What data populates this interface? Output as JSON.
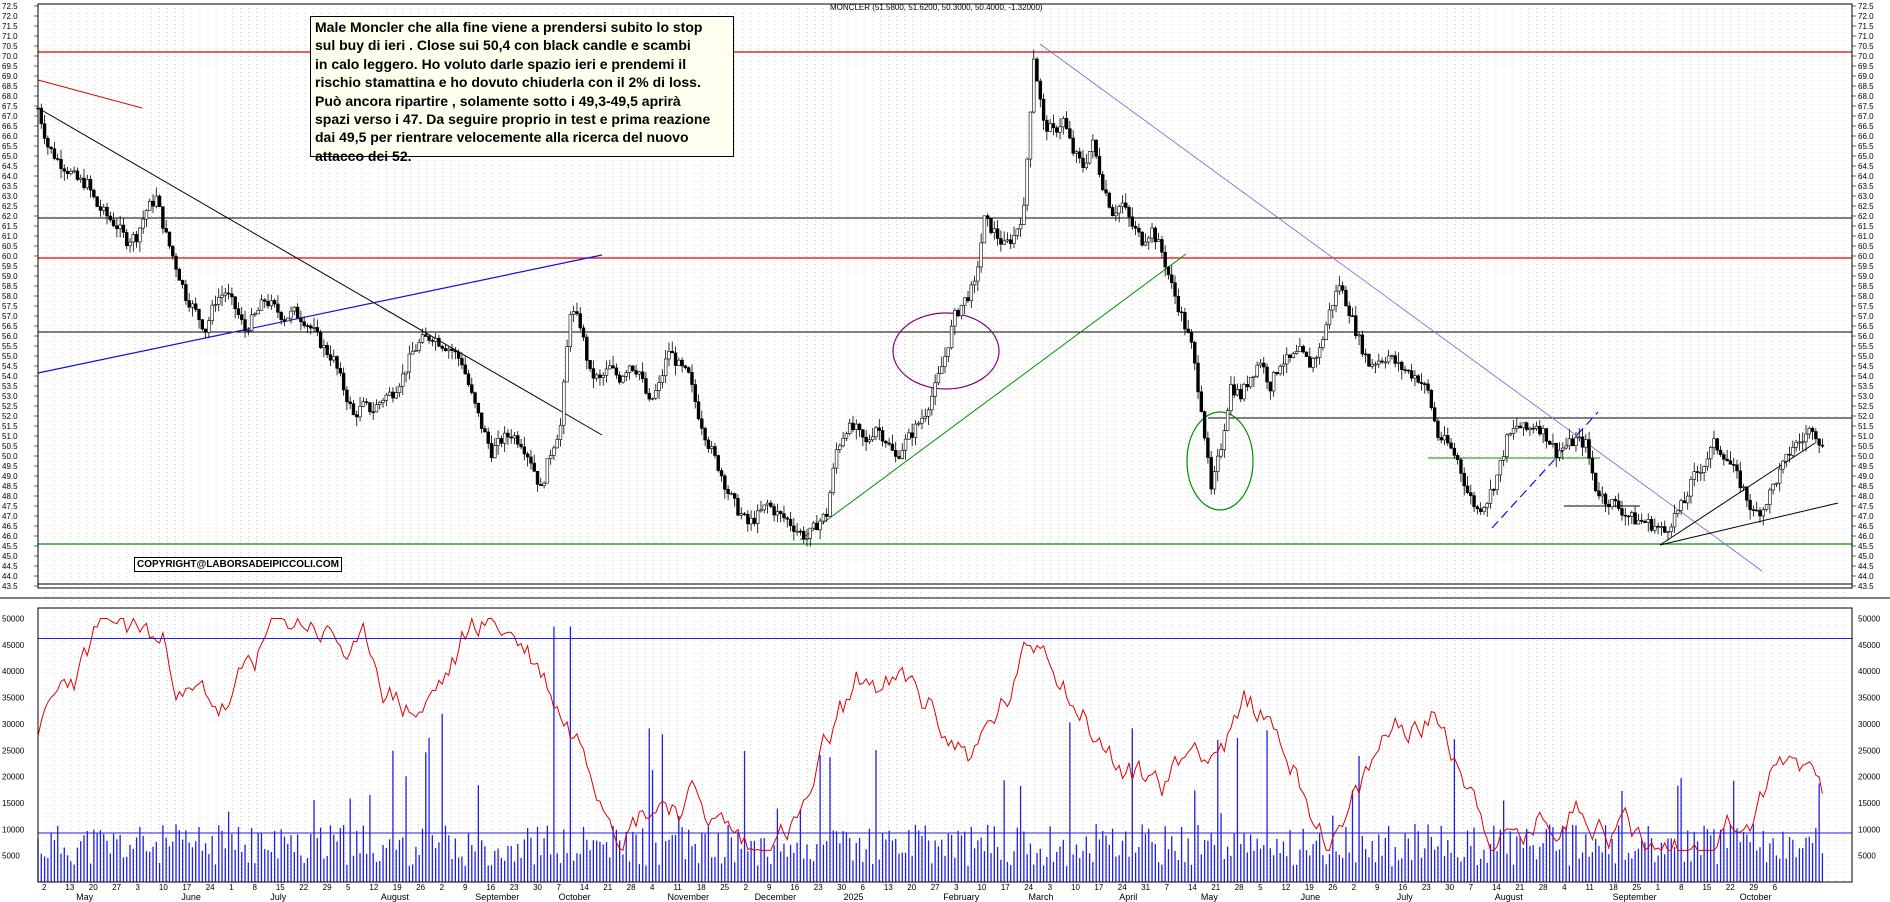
{
  "header": "MONCLER (51.5800, 51.6200, 50.3000, 50.4000, -1.32000)",
  "annotation": "Male Moncler che alla fine viene a prendersi subito lo stop\nsul buy di ieri . Close sui 50,4 con black candle e scambi\nin calo leggero. Ho voluto darle spazio ieri e prendemi il\nrischio stamattina e ho dovuto chiuderla con il 2% di loss.\nPuò ancora ripartire , solamente sotto i 49,3-49,5 aprirà\nspazi verso i 47.  Da seguire proprio in test e prima reazione\ndai 49,5 per rientrare velocemente alla ricerca del nuovo\nattacco dei 52.",
  "copyright": "COPYRIGHT@LABORSADEIPICCOLI.COM",
  "colors": {
    "price_line": "#000000",
    "red_levels": "#e00000",
    "support": "#009000",
    "trend_blue": "#1010e0",
    "trend_light": "#6a6ad0",
    "volume": "#2020e0",
    "volume_avg": "#e00000",
    "circle_purple": "#800080",
    "circle_green": "#009000"
  },
  "chart_data": [
    {
      "type": "candlestick",
      "title": "MONCLER (51.5800, 51.6200, 50.3000, 50.4000, -1.32000)",
      "ylim": [
        43.4,
        72.6
      ],
      "y_ticks": [
        43.5,
        44.0,
        44.5,
        45.0,
        45.5,
        46.0,
        46.5,
        47.0,
        47.5,
        48.0,
        48.5,
        49.0,
        49.5,
        50.0,
        50.5,
        51.0,
        51.5,
        52.0,
        52.5,
        53.0,
        53.5,
        54.0,
        54.5,
        55.0,
        55.5,
        56.0,
        56.5,
        57.0,
        57.5,
        58.0,
        58.5,
        59.0,
        59.5,
        60.0,
        60.5,
        61.0,
        61.5,
        62.0,
        62.5,
        63.0,
        63.5,
        64.0,
        64.5,
        65.0,
        65.5,
        66.0,
        66.5,
        67.0,
        67.5,
        68.0,
        68.5,
        69.0,
        69.5,
        70.0,
        70.5,
        71.0,
        71.5,
        72.0,
        72.5
      ],
      "y_tick_labels": [
        "43.5",
        "44.0",
        "44.5",
        "45.0",
        "45.5",
        "46.0",
        "46.5",
        "47.0",
        "47.5",
        "48.0",
        "48.5",
        "49.0",
        "49.5",
        "50.0",
        "50.5",
        "51.0",
        "51.5",
        "52.0",
        "52.5",
        "53.0",
        "53.5",
        "54.0",
        "54.5",
        "55.0",
        "55.5",
        "56.0",
        "56.5",
        "57.0",
        "57.5",
        "58.0",
        "58.5",
        "59.0",
        "59.5",
        "60.0",
        "60.5",
        "61.0",
        "61.5",
        "62.0",
        "62.5",
        "63.0",
        "63.5",
        "64.0",
        "64.5",
        "65.0",
        "65.5",
        "66.0",
        "66.5",
        "67.0",
        "67.5",
        "68.0",
        "68.5",
        "69.0",
        "69.5",
        "70.0",
        "70.5",
        "71.0",
        "71.5",
        "72.0",
        "72.5"
      ],
      "price_path": [
        [
          0,
          67.4
        ],
        [
          3,
          65.5
        ],
        [
          6,
          64.8
        ],
        [
          9,
          64.3
        ],
        [
          12,
          63.8
        ],
        [
          15,
          63.6
        ],
        [
          18,
          62.5
        ],
        [
          21,
          62.0
        ],
        [
          24,
          61.5
        ],
        [
          27,
          60.8
        ],
        [
          30,
          61.0
        ],
        [
          33,
          62.3
        ],
        [
          36,
          62.9
        ],
        [
          39,
          61.0
        ],
        [
          42,
          59.5
        ],
        [
          45,
          58.0
        ],
        [
          48,
          57.2
        ],
        [
          51,
          56.3
        ],
        [
          54,
          57.8
        ],
        [
          57,
          58.2
        ],
        [
          60,
          57.4
        ],
        [
          63,
          56.3
        ],
        [
          66,
          57.0
        ],
        [
          69,
          57.8
        ],
        [
          72,
          57.4
        ],
        [
          75,
          56.9
        ],
        [
          78,
          57.2
        ],
        [
          81,
          56.8
        ],
        [
          84,
          56.2
        ],
        [
          87,
          55.4
        ],
        [
          90,
          54.8
        ],
        [
          93,
          53.4
        ],
        [
          96,
          52.0
        ],
        [
          99,
          52.5
        ],
        [
          102,
          52.3
        ],
        [
          105,
          52.9
        ],
        [
          108,
          53.2
        ],
        [
          111,
          54.0
        ],
        [
          114,
          55.2
        ],
        [
          117,
          55.8
        ],
        [
          120,
          56.0
        ],
        [
          123,
          55.6
        ],
        [
          126,
          55.3
        ],
        [
          129,
          54.7
        ],
        [
          132,
          53.0
        ],
        [
          135,
          51.5
        ],
        [
          138,
          50.2
        ],
        [
          141,
          50.8
        ],
        [
          144,
          51.1
        ],
        [
          147,
          50.7
        ],
        [
          150,
          49.8
        ],
        [
          153,
          48.3
        ],
        [
          156,
          50.2
        ],
        [
          159,
          51.5
        ],
        [
          162,
          57.3
        ],
        [
          165,
          56.6
        ],
        [
          168,
          54.1
        ],
        [
          171,
          53.8
        ],
        [
          174,
          54.4
        ],
        [
          177,
          53.9
        ],
        [
          180,
          54.6
        ],
        [
          183,
          54.2
        ],
        [
          186,
          52.6
        ],
        [
          189,
          53.5
        ],
        [
          192,
          55.3
        ],
        [
          195,
          54.5
        ],
        [
          198,
          54.0
        ],
        [
          201,
          52.1
        ],
        [
          204,
          50.6
        ],
        [
          207,
          49.5
        ],
        [
          210,
          48.2
        ],
        [
          213,
          47.3
        ],
        [
          216,
          46.6
        ],
        [
          219,
          47.0
        ],
        [
          222,
          47.6
        ],
        [
          225,
          47.1
        ],
        [
          228,
          46.8
        ],
        [
          231,
          46.3
        ],
        [
          234,
          45.9
        ],
        [
          237,
          46.6
        ],
        [
          240,
          47.1
        ],
        [
          243,
          50.3
        ],
        [
          246,
          51.4
        ],
        [
          249,
          51.3
        ],
        [
          252,
          50.6
        ],
        [
          255,
          51.5
        ],
        [
          258,
          50.8
        ],
        [
          261,
          49.9
        ],
        [
          264,
          50.7
        ],
        [
          267,
          51.4
        ],
        [
          270,
          52.2
        ],
        [
          273,
          53.4
        ],
        [
          276,
          55.0
        ],
        [
          279,
          57.0
        ],
        [
          282,
          57.8
        ],
        [
          285,
          58.5
        ],
        [
          288,
          61.8
        ],
        [
          291,
          61.2
        ],
        [
          294,
          60.5
        ],
        [
          297,
          61.0
        ],
        [
          300,
          62.3
        ],
        [
          303,
          70.0
        ],
        [
          306,
          66.6
        ],
        [
          309,
          66.2
        ],
        [
          312,
          66.8
        ],
        [
          315,
          65.2
        ],
        [
          318,
          64.5
        ],
        [
          321,
          65.6
        ],
        [
          324,
          63.6
        ],
        [
          327,
          62.2
        ],
        [
          330,
          62.6
        ],
        [
          333,
          61.5
        ],
        [
          336,
          60.8
        ],
        [
          339,
          61.3
        ],
        [
          342,
          60.2
        ],
        [
          345,
          58.5
        ],
        [
          348,
          57.0
        ],
        [
          351,
          55.5
        ],
        [
          354,
          52.5
        ],
        [
          357,
          48.2
        ],
        [
          360,
          50.5
        ],
        [
          363,
          53.5
        ],
        [
          366,
          53.0
        ],
        [
          369,
          54.0
        ],
        [
          372,
          54.8
        ],
        [
          375,
          53.5
        ],
        [
          378,
          54.7
        ],
        [
          381,
          54.8
        ],
        [
          384,
          55.2
        ],
        [
          387,
          54.6
        ],
        [
          390,
          55.3
        ],
        [
          393,
          57.2
        ],
        [
          396,
          58.6
        ],
        [
          399,
          57.3
        ],
        [
          402,
          55.8
        ],
        [
          405,
          54.6
        ],
        [
          408,
          54.8
        ],
        [
          411,
          55.0
        ],
        [
          414,
          54.5
        ],
        [
          417,
          54.2
        ],
        [
          420,
          53.9
        ],
        [
          423,
          53.2
        ],
        [
          426,
          51.0
        ],
        [
          429,
          50.6
        ],
        [
          432,
          49.8
        ],
        [
          435,
          48.2
        ],
        [
          438,
          47.3
        ],
        [
          441,
          47.8
        ],
        [
          444,
          49.0
        ],
        [
          447,
          50.8
        ],
        [
          450,
          51.5
        ],
        [
          453,
          51.3
        ],
        [
          456,
          51.6
        ],
        [
          459,
          51.0
        ],
        [
          462,
          50.2
        ],
        [
          465,
          50.5
        ],
        [
          468,
          50.8
        ],
        [
          471,
          50.6
        ],
        [
          474,
          48.4
        ],
        [
          477,
          47.8
        ],
        [
          480,
          47.6
        ],
        [
          483,
          47.1
        ],
        [
          486,
          46.8
        ],
        [
          489,
          46.7
        ],
        [
          492,
          46.5
        ],
        [
          495,
          46.2
        ],
        [
          498,
          47.0
        ],
        [
          501,
          47.7
        ],
        [
          504,
          49.0
        ],
        [
          507,
          49.6
        ],
        [
          510,
          50.6
        ],
        [
          513,
          50.1
        ],
        [
          516,
          49.3
        ],
        [
          519,
          48.3
        ],
        [
          522,
          47.1
        ],
        [
          525,
          47.4
        ],
        [
          528,
          48.5
        ],
        [
          531,
          49.5
        ],
        [
          534,
          50.5
        ],
        [
          537,
          50.8
        ],
        [
          540,
          51.5
        ],
        [
          543,
          50.4
        ]
      ],
      "x_range_index": [
        0,
        552
      ],
      "month_labels": [
        "May",
        "June",
        "July",
        "August",
        "September",
        "October",
        "November",
        "December",
        "2025",
        "February",
        "March",
        "April",
        "May",
        "June",
        "July",
        "August",
        "September",
        "October"
      ],
      "day_labels": [
        "2",
        "13",
        "20",
        "27",
        "3",
        "10",
        "17",
        "24",
        "1",
        "8",
        "15",
        "22",
        "29",
        "5",
        "12",
        "19",
        "26",
        "2",
        "9",
        "16",
        "23",
        "30",
        "7",
        "14",
        "21",
        "28",
        "4",
        "11",
        "18",
        "25",
        "2",
        "9",
        "16",
        "23",
        "30",
        "6",
        "13",
        "20",
        "27",
        "3",
        "10",
        "17",
        "24",
        "3",
        "10",
        "17",
        "24",
        "31",
        "7",
        "14",
        "21",
        "28",
        "5",
        "12",
        "19",
        "26",
        "2",
        "9",
        "16",
        "23",
        "30",
        "7",
        "14",
        "21",
        "28",
        "4",
        "11",
        "18",
        "25",
        "1",
        "8",
        "15",
        "22",
        "29",
        "6"
      ],
      "horizontal_levels": {
        "red": [
          70.2,
          59.9
        ],
        "black": [
          61.9,
          56.2,
          51.9,
          43.6
        ],
        "green": [
          45.6
        ]
      },
      "annotation_levels_text": [
        "50,4",
        "49,3-49,5",
        "47",
        "52"
      ]
    },
    {
      "type": "bar",
      "title": "",
      "ylim": [
        0,
        52000
      ],
      "y_ticks": [
        5000,
        10000,
        15000,
        20000,
        25000,
        30000,
        35000,
        40000,
        45000,
        50000
      ],
      "y_tick_labels": [
        "5000",
        "10000",
        "15000",
        "20000",
        "25000",
        "30000",
        "35000",
        "40000",
        "45000",
        "50000"
      ],
      "series": [
        {
          "values": "volume bars (approx. 5000-12000 typical, peaks ~48000 in late September)"
        },
        {
          "values": "red average line oscillating 8000-50000"
        }
      ],
      "reference_lines": [
        46200,
        9300
      ]
    }
  ]
}
